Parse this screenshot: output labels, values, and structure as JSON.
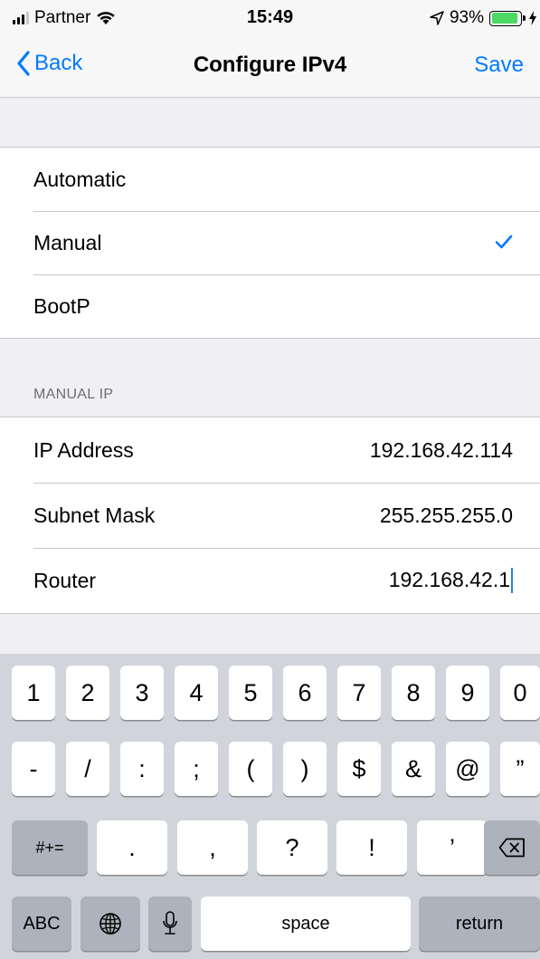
{
  "status_bar": {
    "carrier": "Partner",
    "time": "15:49",
    "battery": "93%"
  },
  "nav": {
    "back_label": "Back",
    "title": "Configure IPv4",
    "save_label": "Save"
  },
  "modes": [
    {
      "label": "Automatic",
      "selected": false
    },
    {
      "label": "Manual",
      "selected": true
    },
    {
      "label": "BootP",
      "selected": false
    }
  ],
  "manual_ip": {
    "header": "MANUAL IP",
    "fields": [
      {
        "label": "IP Address",
        "value": "192.168.42.114"
      },
      {
        "label": "Subnet Mask",
        "value": "255.255.255.0"
      },
      {
        "label": "Router",
        "value": "192.168.42.1"
      }
    ]
  },
  "keyboard": {
    "row1": [
      "1",
      "2",
      "3",
      "4",
      "5",
      "6",
      "7",
      "8",
      "9",
      "0"
    ],
    "row2": [
      "-",
      "/",
      ":",
      ";",
      "(",
      ")",
      "$",
      "&",
      "@",
      "”"
    ],
    "row3": {
      "mode": "#+=",
      "keys": [
        ".",
        ",",
        "?",
        "!",
        "’"
      ]
    },
    "row4": {
      "abc": "ABC",
      "space": "space",
      "return": "return"
    }
  },
  "colors": {
    "accent": "#007aff",
    "battery": "#4cd964",
    "cursor": "#2b7cf6"
  }
}
